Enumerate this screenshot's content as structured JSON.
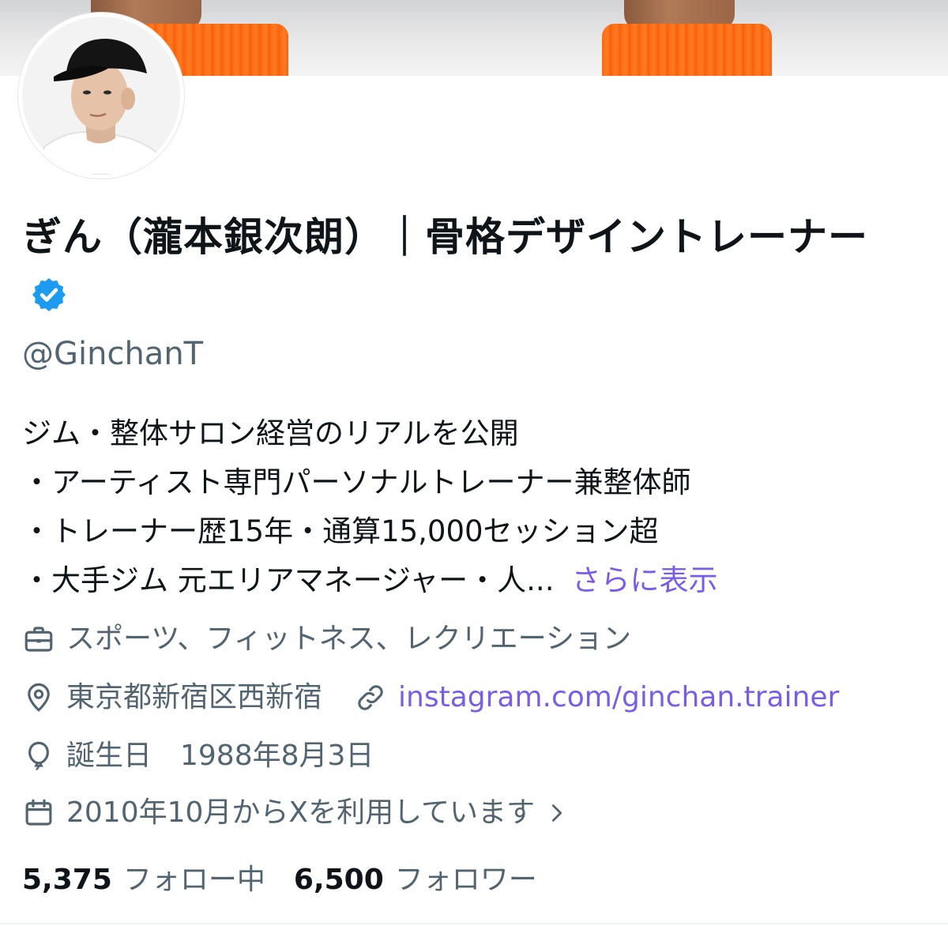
{
  "profile": {
    "name": "ぎん（瀧本銀次朗）｜骨格デザイントレーナー",
    "handle": "@GinchanT",
    "bio_lines": [
      "ジム・整体サロン経営のリアルを公開",
      "・アーティスト専門パーソナルトレーナー兼整体師",
      "・トレーナー歴15年・通算15,000セッション超",
      "・大手ジム 元エリアマネージャー・人..."
    ],
    "show_more_label": "さらに表示",
    "category": "スポーツ、フィットネス、レクリエーション",
    "location": "東京都新宿区西新宿",
    "website": "instagram.com/ginchan.trainer",
    "birthday": "誕生日　1988年8月3日",
    "joined": "2010年10月からXを利用しています",
    "following_count": "5,375",
    "following_label": "フォロー中",
    "followers_count": "6,500",
    "followers_label": "フォロワー"
  },
  "icons": {
    "category": "briefcase-icon",
    "location": "location-pin-icon",
    "website": "link-icon",
    "birthday": "balloon-icon",
    "joined": "calendar-icon",
    "verified": "verified-badge-icon",
    "joined_more": "chevron-right-icon"
  },
  "colors": {
    "text_primary": "#0f1419",
    "text_secondary": "#536471",
    "link": "#7b5ce6",
    "verified": "#1d9bf0",
    "banner_orange": "#ff6a10"
  }
}
